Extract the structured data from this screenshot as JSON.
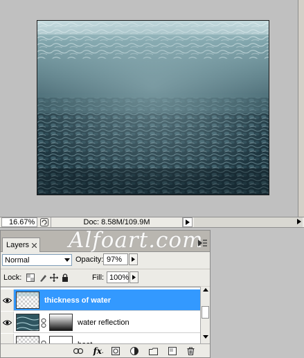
{
  "document": {
    "zoom": "16.67%",
    "doc_size": "Doc: 8.58M/109.9M"
  },
  "watermark": "Alfoart.com",
  "layers_panel": {
    "tab_label": "Layers",
    "blend_mode": "Normal",
    "opacity_label": "Opacity:",
    "opacity_value": "97%",
    "lock_label": "Lock:",
    "fill_label": "Fill:",
    "fill_value": "100%",
    "layers": [
      {
        "name": "thickness of water",
        "selected": true,
        "visible": true
      },
      {
        "name": "water reflection",
        "selected": false,
        "visible": true,
        "has_mask": true
      },
      {
        "name": "boat",
        "selected": false,
        "visible": false,
        "has_mask": true
      }
    ],
    "footer_icons": [
      "link-layers-icon",
      "fx-icon",
      "add-mask-icon",
      "adjustment-layer-icon",
      "new-group-icon",
      "new-layer-icon",
      "trash-icon"
    ]
  },
  "colors": {
    "selection": "#3399ff",
    "panel_bg": "#ecebe6",
    "canvas_bg": "#c0c0c0"
  }
}
